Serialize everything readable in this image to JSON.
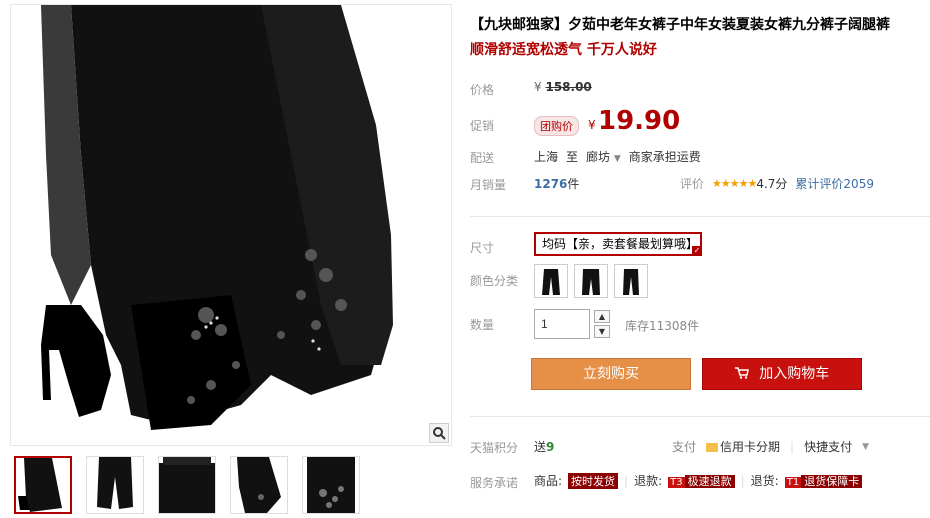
{
  "product": {
    "title": "【九块邮独家】夕茹中老年女裤子中年女装夏装女裤九分裤子阔腿裤",
    "subtitle": "顺滑舒适宽松透气 千万人说好"
  },
  "price": {
    "label": "价格",
    "currency": "¥",
    "original": "158.00"
  },
  "promo": {
    "label": "促销",
    "badge": "团购价",
    "currency": "¥",
    "value": "19.90"
  },
  "delivery": {
    "label": "配送",
    "from": "上海",
    "to_word": "至",
    "dest": "廊坊",
    "note": "商家承担运费"
  },
  "sales": {
    "label": "月销量",
    "count": "1276",
    "unit": "件",
    "rating_label": "评价",
    "stars": "★★★★★",
    "score": "4.7分",
    "reviews": "累计评价2059"
  },
  "size": {
    "label": "尺寸",
    "option": "均码【亲，卖套餐最划算哦】",
    "check": "✓"
  },
  "color": {
    "label": "颜色分类"
  },
  "quantity": {
    "label": "数量",
    "value": "1",
    "up": "▲",
    "down": "▼",
    "stock": "库存11308件"
  },
  "buttons": {
    "buy_now": "立刻购买",
    "add_cart": "加入购物车"
  },
  "points": {
    "label": "天猫积分",
    "prefix": "送",
    "value": "9"
  },
  "payment": {
    "label": "支付",
    "card": "信用卡分期",
    "fast": "快捷支付",
    "caret": "▼"
  },
  "service": {
    "label": "服务承诺",
    "goods": "商品:",
    "goods_tag": "按时发货",
    "refund": "退款:",
    "refund_t3": "T3",
    "refund_tag": "极速退款",
    "returns": "退货:",
    "returns_t1": "T1",
    "returns_tag": "退货保障卡"
  },
  "icons": {
    "zoom": "magnifier-icon",
    "cart": "cart-icon",
    "card": "credit-card-icon"
  },
  "colors": {
    "accent": "#b00000",
    "buy": "#e58f47",
    "cart": "#c8100e",
    "link": "#3a6ea5"
  }
}
